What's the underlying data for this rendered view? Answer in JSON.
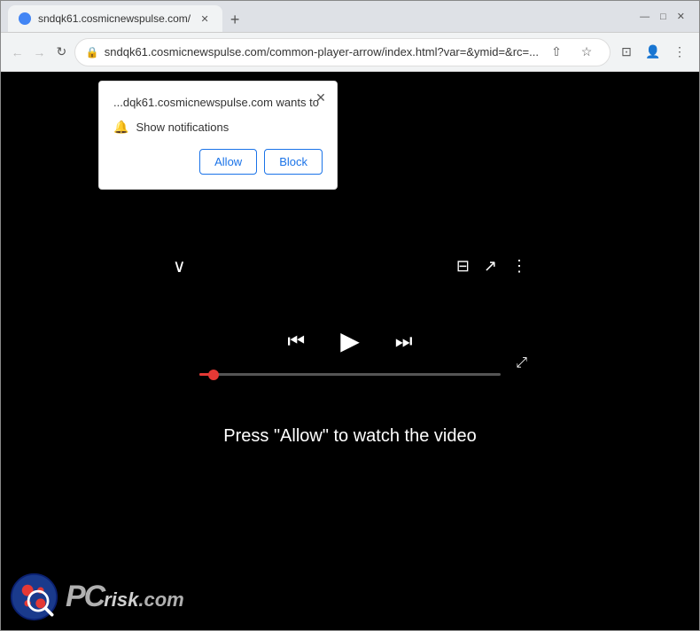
{
  "browser": {
    "tab": {
      "title": "sndqk61.cosmicnewspulse.com/",
      "favicon": "globe"
    },
    "new_tab_label": "+",
    "window_controls": {
      "minimize": "—",
      "maximize": "□",
      "close": "✕"
    },
    "toolbar": {
      "back_label": "←",
      "forward_label": "→",
      "reload_label": "↻",
      "address": "sndqk61.cosmicnewspulse.com/common-player-arrow/index.html?var=&ymid=&rc=...",
      "bookmark_label": "☆",
      "profile_label": "👤",
      "menu_label": "⋮",
      "share_label": "⇧"
    }
  },
  "notification_popup": {
    "site_text": "...dqk61.cosmicnewspulse.com wants to",
    "permission_text": "Show notifications",
    "allow_label": "Allow",
    "block_label": "Block",
    "close_label": "✕"
  },
  "video_player": {
    "message": "Press \"Allow\" to watch the video",
    "progress_percent": 4,
    "transport": {
      "prev_label": "⏮",
      "play_label": "▶",
      "next_label": "⏭"
    },
    "icons": {
      "chevron_down": "∨",
      "queue_label": "⊟",
      "share_label": "↗",
      "more_label": "⋮",
      "fullscreen_label": "⤢"
    }
  },
  "watermark": {
    "text": "PCrisk.com"
  }
}
